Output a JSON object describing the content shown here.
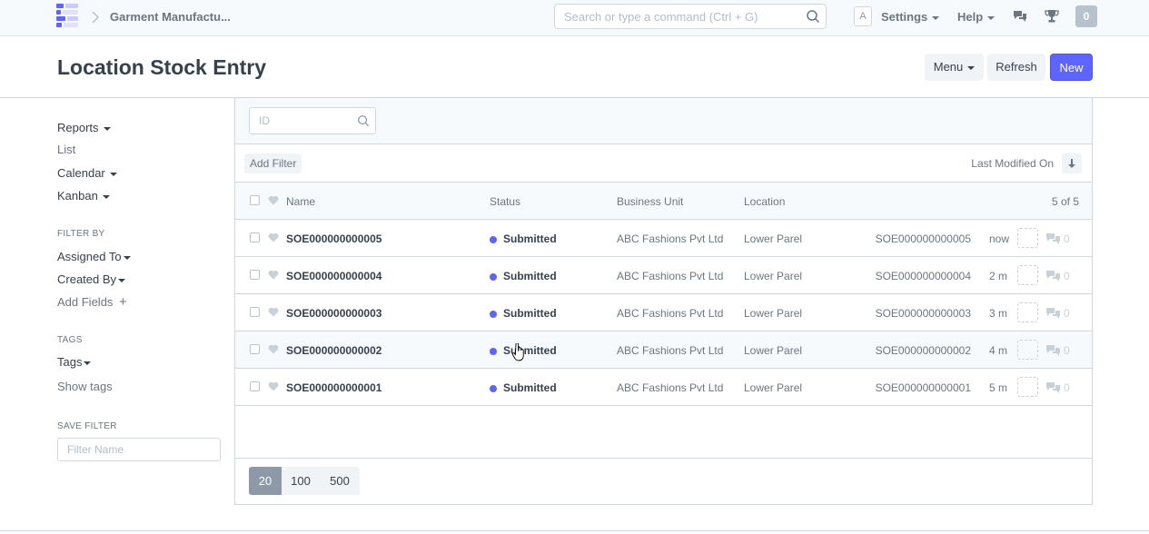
{
  "navbar": {
    "breadcrumb": "Garment Manufactu...",
    "search_placeholder": "Search or type a command (Ctrl + G)",
    "avatar_letter": "A",
    "settings_label": "Settings",
    "help_label": "Help",
    "notifications_count": "0"
  },
  "page": {
    "title": "Location Stock Entry",
    "menu_label": "Menu",
    "refresh_label": "Refresh",
    "new_label": "New"
  },
  "sidebar": {
    "reports": "Reports",
    "list": "List",
    "calendar": "Calendar",
    "kanban": "Kanban",
    "filter_by_label": "FILTER BY",
    "assigned_to": "Assigned To",
    "created_by": "Created By",
    "add_fields": "Add Fields",
    "add_fields_icon": "+",
    "tags_label": "TAGS",
    "tags": "Tags",
    "show_tags": "Show tags",
    "save_filter_label": "SAVE FILTER",
    "filter_name_placeholder": "Filter Name"
  },
  "list": {
    "id_placeholder": "ID",
    "add_filter": "Add Filter",
    "sort_label": "Last Modified On",
    "columns": {
      "name": "Name",
      "status": "Status",
      "business_unit": "Business Unit",
      "location": "Location"
    },
    "count": "5 of 5",
    "rows": [
      {
        "name": "SOE000000000005",
        "status": "Submitted",
        "business_unit": "ABC Fashions Pvt Ltd",
        "location": "Lower Parel",
        "id": "SOE000000000005",
        "time": "now",
        "comments": "0"
      },
      {
        "name": "SOE000000000004",
        "status": "Submitted",
        "business_unit": "ABC Fashions Pvt Ltd",
        "location": "Lower Parel",
        "id": "SOE000000000004",
        "time": "2 m",
        "comments": "0"
      },
      {
        "name": "SOE000000000003",
        "status": "Submitted",
        "business_unit": "ABC Fashions Pvt Ltd",
        "location": "Lower Parel",
        "id": "SOE000000000003",
        "time": "3 m",
        "comments": "0"
      },
      {
        "name": "SOE000000000002",
        "status": "Submitted",
        "business_unit": "ABC Fashions Pvt Ltd",
        "location": "Lower Parel",
        "id": "SOE000000000002",
        "time": "4 m",
        "comments": "0"
      },
      {
        "name": "SOE000000000001",
        "status": "Submitted",
        "business_unit": "ABC Fashions Pvt Ltd",
        "location": "Lower Parel",
        "id": "SOE000000000001",
        "time": "5 m",
        "comments": "0"
      }
    ],
    "page_sizes": [
      "20",
      "100",
      "500"
    ],
    "active_page_size": "20"
  },
  "colors": {
    "primary": "#5e64ff",
    "status_dot": "#5e64ff",
    "text": "#36414c",
    "muted": "#6c7680"
  },
  "icons": {
    "logo": "frappe-logo-icon",
    "search": "search-icon",
    "chat": "chat-icon",
    "trophy": "trophy-icon",
    "heart": "heart-icon",
    "sort": "sort-descending-icon",
    "comment": "comment-icon"
  }
}
